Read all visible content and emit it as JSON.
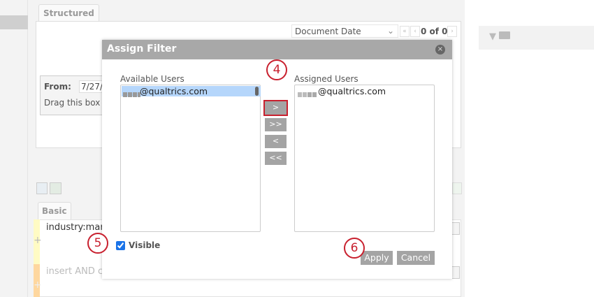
{
  "background": {
    "tab_structured": "Structured",
    "sort_select": "Document Date",
    "pager": {
      "first": "«",
      "prev": "‹",
      "count": "0 of 0",
      "next": "›"
    },
    "from_label": "From:",
    "from_value": "7/27/2",
    "drag_hint": "Drag this box",
    "tab_basic": "Basic",
    "row1_text": "industry:mar",
    "row2_placeholder": "insert AND co"
  },
  "dialog": {
    "title": "Assign Filter",
    "close": "×",
    "available_label": "Available Users",
    "available_users": [
      "@qualtrics.com"
    ],
    "assigned_label": "Assigned Users",
    "assigned_users": [
      "@qualtrics.com"
    ],
    "move": {
      "add": ">",
      "add_all": ">>",
      "remove": "<",
      "remove_all": "<<"
    },
    "visible_label": "Visible",
    "visible_checked": true,
    "apply": "Apply",
    "cancel": "Cancel"
  },
  "callouts": {
    "step4": "4",
    "step5": "5",
    "step6": "6"
  },
  "colors": {
    "callout": "#c8202e",
    "button": "#a4a4a4",
    "selected": "#b5d6fb"
  }
}
